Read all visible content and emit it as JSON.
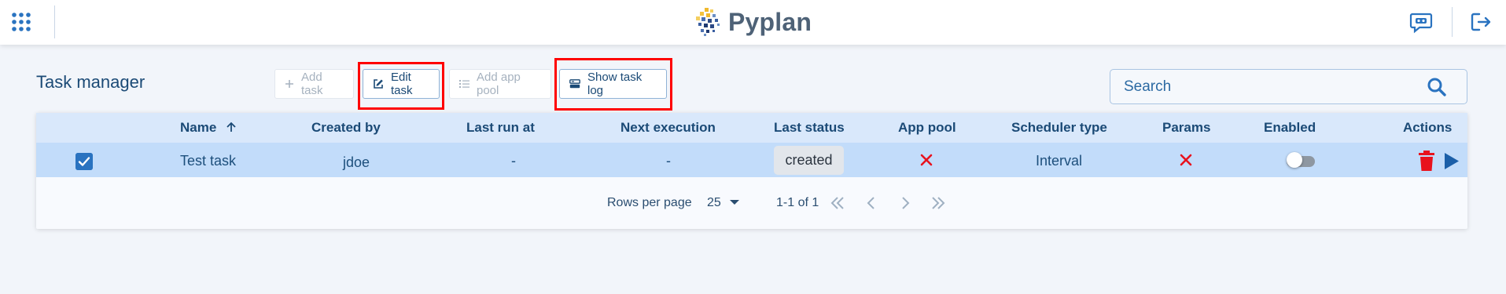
{
  "app": {
    "name": "Pyplan"
  },
  "page": {
    "title": "Task manager"
  },
  "toolbar": {
    "add_task": "Add task",
    "edit_task": "Edit task",
    "add_app_pool": "Add app pool",
    "show_task_log": "Show task log"
  },
  "search": {
    "placeholder": "Search"
  },
  "table": {
    "columns": {
      "name": "Name",
      "created_by": "Created by",
      "last_run_at": "Last run at",
      "next_execution": "Next execution",
      "last_status": "Last status",
      "app_pool": "App pool",
      "scheduler_type": "Scheduler type",
      "params": "Params",
      "enabled": "Enabled",
      "actions": "Actions"
    },
    "rows": [
      {
        "selected": true,
        "name": "Test task",
        "created_by": "jdoe",
        "last_run_at": "-",
        "next_execution": "-",
        "last_status": "created",
        "app_pool": "none",
        "scheduler_type": "Interval",
        "params": "none",
        "enabled": false
      }
    ]
  },
  "pagination": {
    "rows_per_page_label": "Rows per page",
    "rows_per_page_value": "25",
    "range": "1-1 of 1"
  },
  "colors": {
    "accent": "#2a73c0",
    "highlight": "#ff0000",
    "header_bg": "#d9e8fb",
    "selected_row_bg": "#c2dcfa",
    "delete_red": "#e8121d",
    "run_blue": "#1b5fa8"
  },
  "icons": [
    "apps-grid-icon",
    "pyplan-logo-icon",
    "chat-bot-icon",
    "logout-icon",
    "plus-icon",
    "edit-icon",
    "list-icon",
    "task-log-icon",
    "search-icon",
    "sort-up-icon",
    "checkbox-checked-icon",
    "x-mark-icon",
    "toggle-switch",
    "trash-icon",
    "play-icon",
    "chevron-down-icon",
    "first-page-icon",
    "prev-page-icon",
    "next-page-icon",
    "last-page-icon"
  ]
}
